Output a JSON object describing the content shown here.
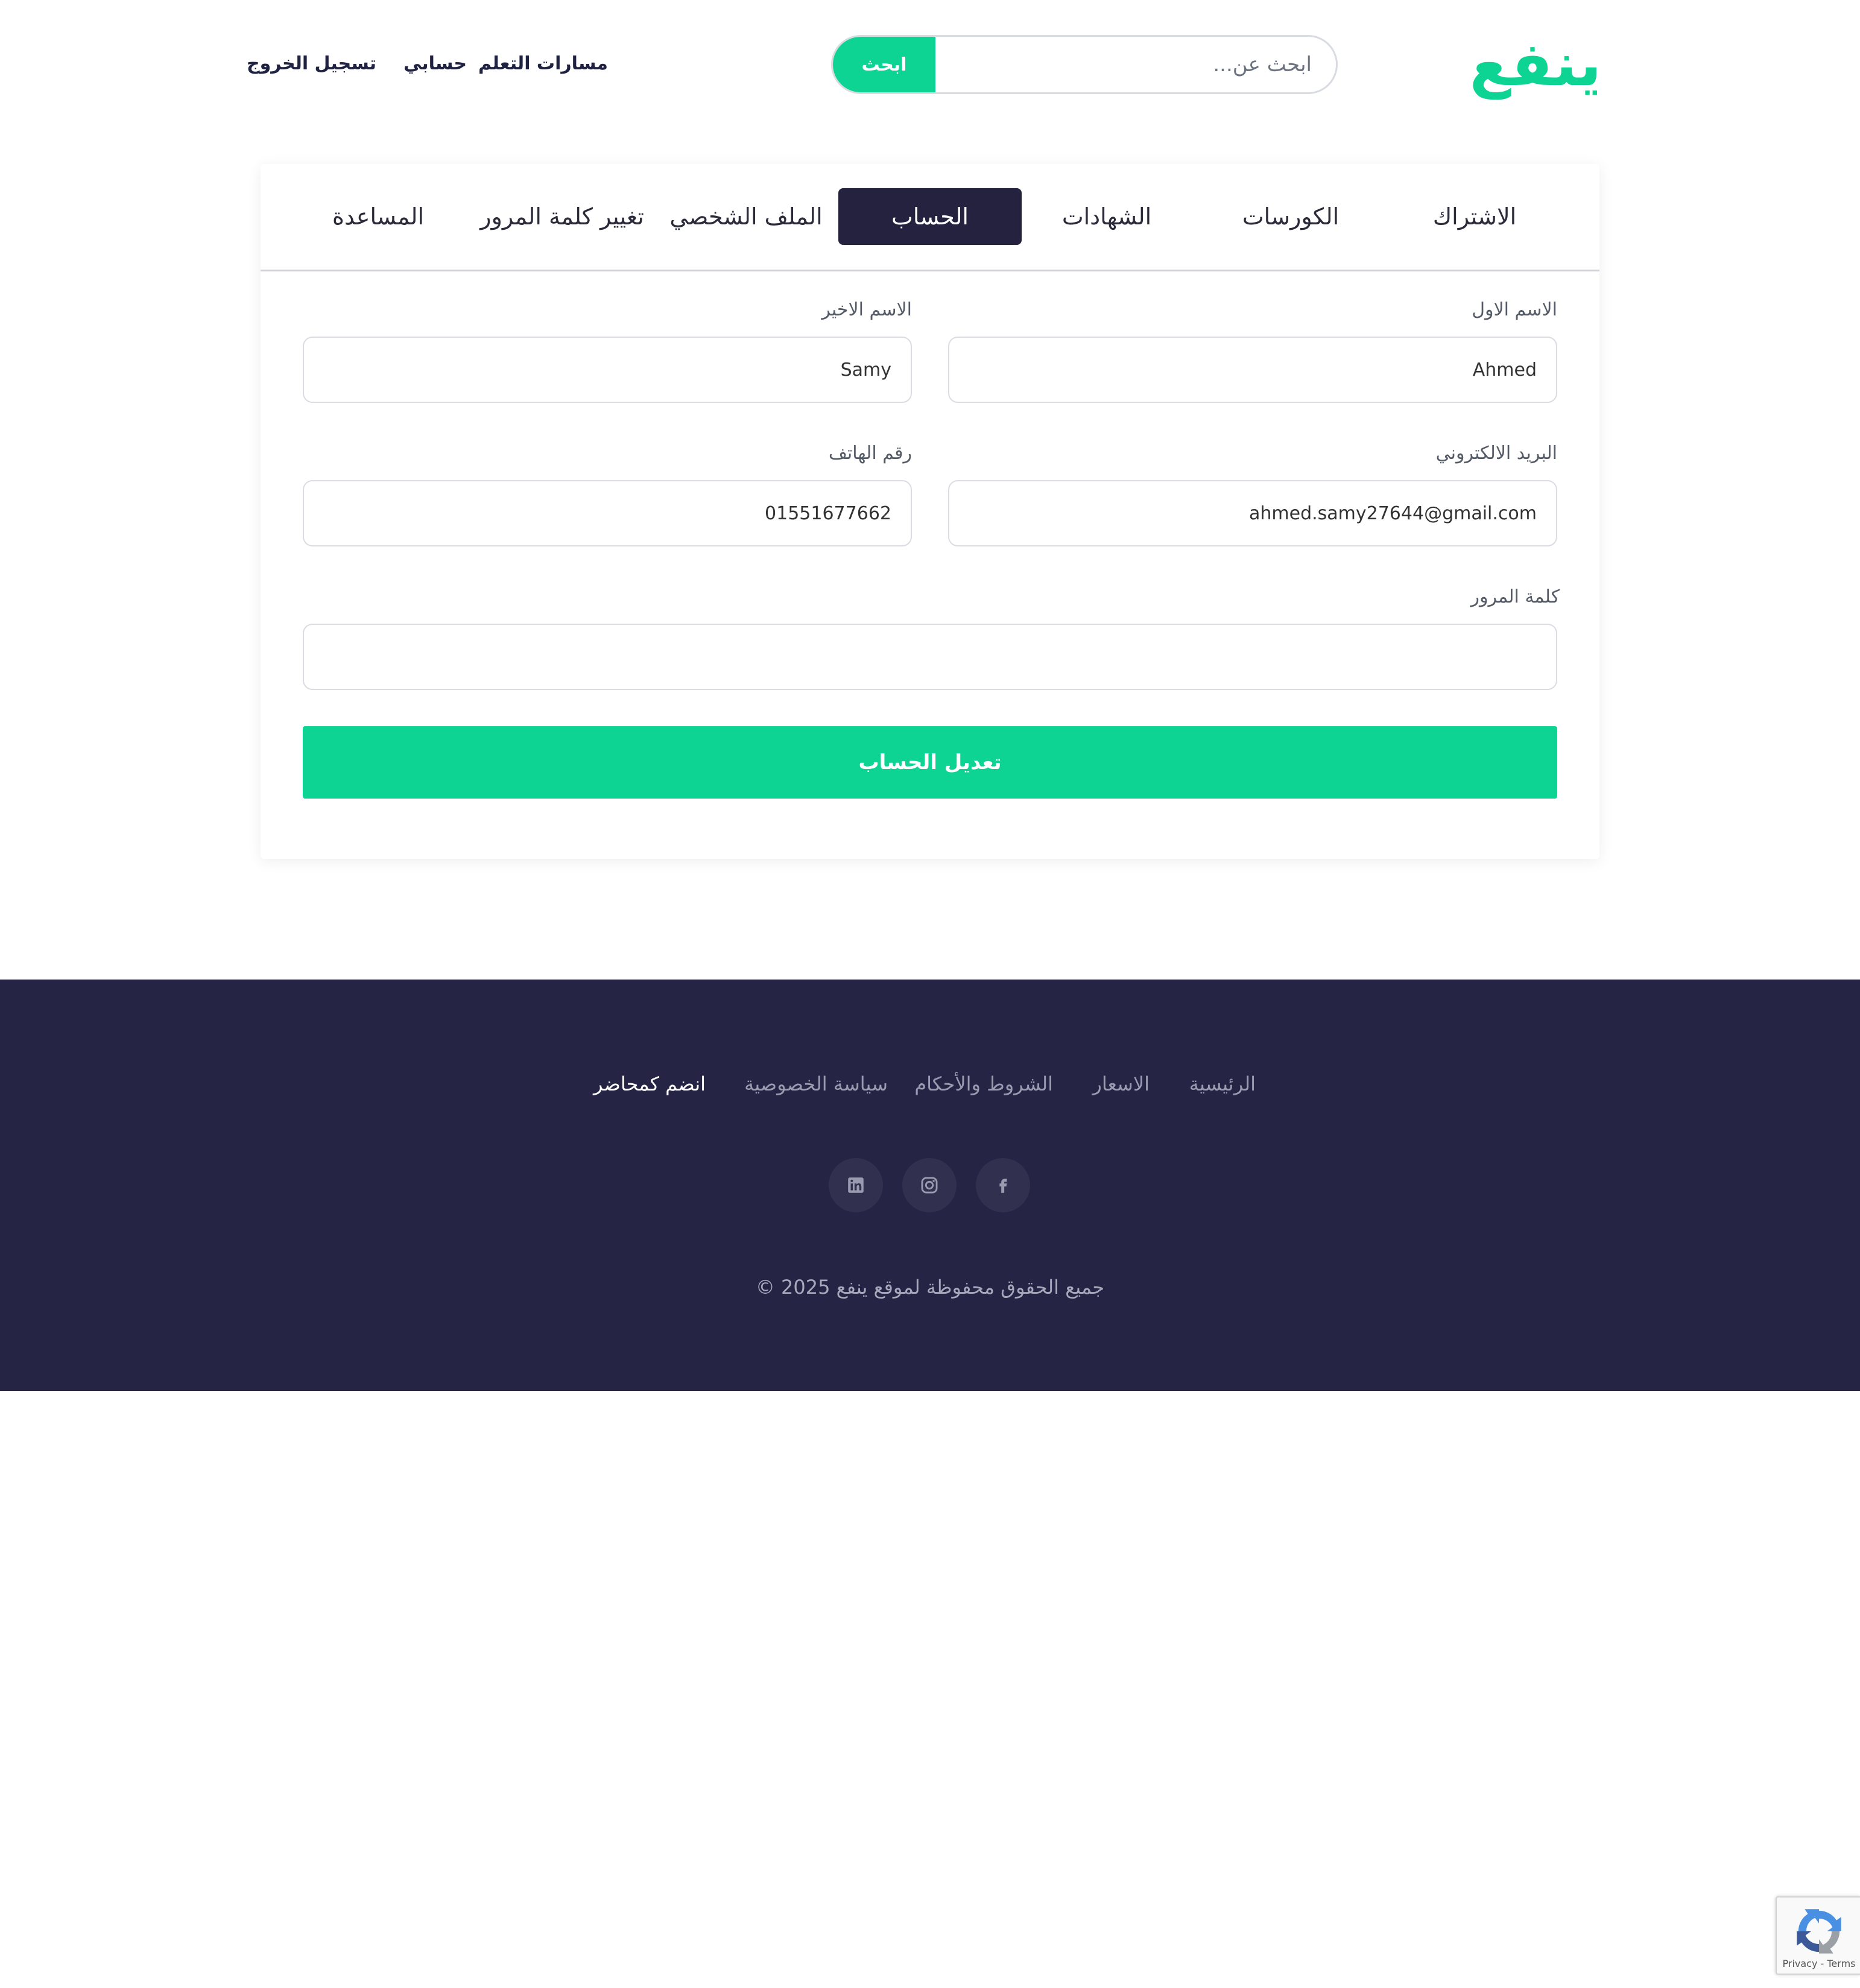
{
  "header": {
    "logo_text": "ينفع",
    "search": {
      "placeholder": "ابحث عن...",
      "button_label": "ابحث"
    },
    "nav": [
      {
        "label": "مسارات التعلم"
      },
      {
        "label": "حسابي"
      },
      {
        "label": "تسجيل الخروج"
      }
    ]
  },
  "tabs": [
    {
      "label": "الاشتراك",
      "active": false
    },
    {
      "label": "الكورسات",
      "active": false
    },
    {
      "label": "الشهادات",
      "active": false
    },
    {
      "label": "الحساب",
      "active": true
    },
    {
      "label": "الملف الشخصي",
      "active": false
    },
    {
      "label": "تغيير كلمة المرور",
      "active": false
    },
    {
      "label": "المساعدة",
      "active": false
    }
  ],
  "form": {
    "first_name": {
      "label": "الاسم الاول",
      "value": "Ahmed"
    },
    "last_name": {
      "label": "الاسم الاخير",
      "value": "Samy"
    },
    "email": {
      "label": "البريد الالكتروني",
      "value": "ahmed.samy27644@gmail.com"
    },
    "phone": {
      "label": "رقم الهاتف",
      "value": "01551677662"
    },
    "password": {
      "label": "كلمة المرور",
      "value": ""
    },
    "submit_label": "تعديل الحساب"
  },
  "footer": {
    "links": [
      {
        "label": "الرئيسية"
      },
      {
        "label": "الاسعار"
      },
      {
        "label": "الشروط والأحكام"
      },
      {
        "label": "سياسة الخصوصية"
      },
      {
        "label": "انضم كمحاضر"
      }
    ],
    "social": [
      {
        "icon": "facebook-icon"
      },
      {
        "icon": "instagram-icon"
      },
      {
        "icon": "linkedin-icon"
      }
    ],
    "copyright": "جميع الحقوق محفوظة لموقع ينفع 2025 ©"
  },
  "recaptcha": {
    "text": "Privacy - Terms"
  },
  "colors": {
    "accent": "#0dd492",
    "dark": "#252445",
    "active_tab": "#24223f"
  }
}
